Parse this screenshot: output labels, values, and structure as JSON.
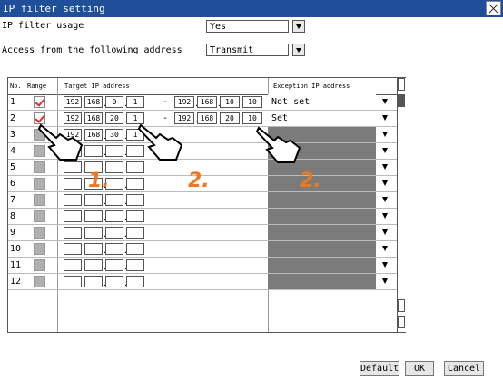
{
  "window": {
    "title": "IP filter setting"
  },
  "settings": {
    "usage_label": "IP filter usage",
    "usage_value": "Yes",
    "access_label": "Access from the following address",
    "access_value": "Transmit"
  },
  "table": {
    "headers": {
      "no": "No.",
      "range": "Range",
      "target": "Target IP address",
      "exception": "Exception IP address"
    },
    "rows": [
      {
        "no": "1",
        "range": true,
        "ip1": [
          "192",
          "168",
          "0",
          "1"
        ],
        "ip2": [
          "192",
          "168",
          "10",
          "10"
        ],
        "exception": "Not set"
      },
      {
        "no": "2",
        "range": true,
        "ip1": [
          "192",
          "168",
          "20",
          "1"
        ],
        "ip2": [
          "192",
          "168",
          "20",
          "10"
        ],
        "exception": "Set"
      },
      {
        "no": "3",
        "range": false,
        "ip1": [
          "192",
          "168",
          "30",
          "1"
        ],
        "ip2": [],
        "exception": ""
      },
      {
        "no": "4",
        "range": false,
        "ip1": [],
        "ip2": [],
        "exception": ""
      },
      {
        "no": "5",
        "range": false,
        "ip1": [],
        "ip2": [],
        "exception": ""
      },
      {
        "no": "6",
        "range": false,
        "ip1": [],
        "ip2": [],
        "exception": ""
      },
      {
        "no": "7",
        "range": false,
        "ip1": [],
        "ip2": [],
        "exception": ""
      },
      {
        "no": "8",
        "range": false,
        "ip1": [],
        "ip2": [],
        "exception": ""
      },
      {
        "no": "9",
        "range": false,
        "ip1": [],
        "ip2": [],
        "exception": ""
      },
      {
        "no": "10",
        "range": false,
        "ip1": [],
        "ip2": [],
        "exception": ""
      },
      {
        "no": "11",
        "range": false,
        "ip1": [],
        "ip2": [],
        "exception": ""
      },
      {
        "no": "12",
        "range": false,
        "ip1": [],
        "ip2": [],
        "exception": ""
      }
    ]
  },
  "annotations": {
    "step1": "1.",
    "step2a": "2.",
    "step2b": "2."
  },
  "buttons": {
    "default": "Default",
    "ok": "OK",
    "cancel": "Cancel"
  },
  "colors": {
    "titlebar": "#1f4f98",
    "step": "#ee7722",
    "check": "#e03030",
    "disabled": "#7b7b7b"
  },
  "icons": {
    "close": "close-icon",
    "dropdown": "chevron-down-icon",
    "hand": "pointing-hand-icon"
  }
}
